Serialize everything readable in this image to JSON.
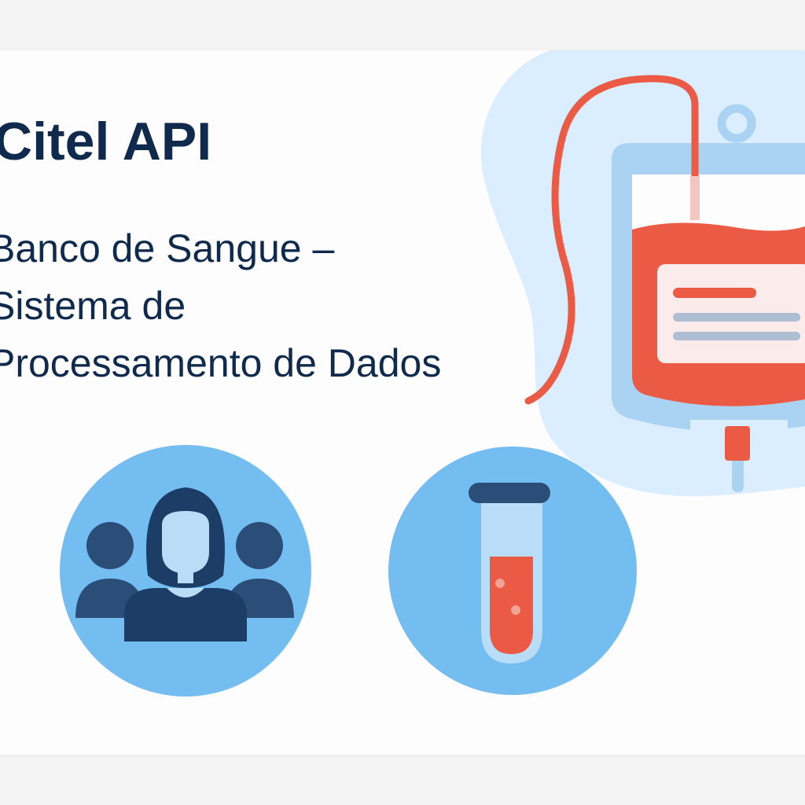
{
  "hero": {
    "title": "Citel API",
    "subtitle_lines": [
      "Banco de Sangue –",
      "Sistema de",
      "Processamento de Dados"
    ]
  },
  "icons": {
    "blood_bag": "blood-bag-icon",
    "people": "people-group-icon",
    "test_tube": "test-tube-icon"
  },
  "colors": {
    "text": "#0f2a4d",
    "blood_red": "#ea5a45",
    "light_blue": "#dbeeff",
    "circle_blue": "#74bdf0",
    "navy": "#1c3e66"
  }
}
